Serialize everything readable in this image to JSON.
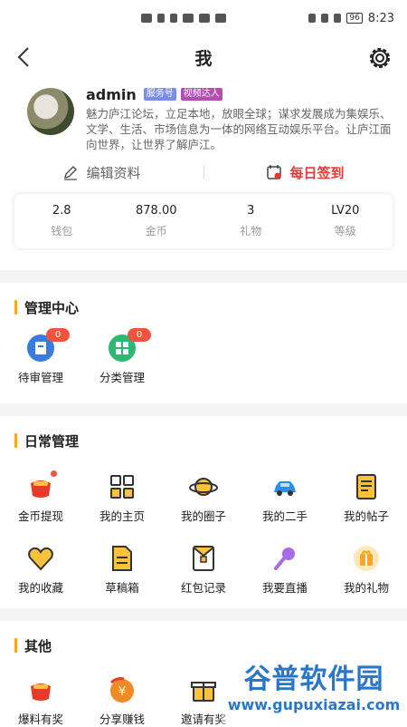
{
  "status_bar": {
    "time": "8:23",
    "battery": "96"
  },
  "nav": {
    "title": "我"
  },
  "profile": {
    "username": "admin",
    "tags": [
      "服务号",
      "视频达人"
    ],
    "description": "魅力庐江论坛，立足本地，放眼全球；谋求发展成为集娱乐、文学、生活、市场信息为一体的网络互动娱乐平台。让庐江面向世界，让世界了解庐江。"
  },
  "actions": {
    "edit_label": "编辑资料",
    "sign_label": "每日签到"
  },
  "stats": [
    {
      "value": "2.8",
      "label": "钱包"
    },
    {
      "value": "878.00",
      "label": "金币"
    },
    {
      "value": "3",
      "label": "礼物"
    },
    {
      "value": "LV20",
      "label": "等级"
    }
  ],
  "sections": {
    "manage": {
      "title": "管理中心",
      "items": [
        {
          "label": "待审管理",
          "badge": "0",
          "icon": "review-icon"
        },
        {
          "label": "分类管理",
          "badge": "0",
          "icon": "category-icon"
        }
      ]
    },
    "daily": {
      "title": "日常管理",
      "items": [
        {
          "label": "金币提现",
          "icon": "coin-withdraw-icon"
        },
        {
          "label": "我的主页",
          "icon": "grid-home-icon"
        },
        {
          "label": "我的圈子",
          "icon": "planet-icon"
        },
        {
          "label": "我的二手",
          "icon": "car-icon"
        },
        {
          "label": "我的帖子",
          "icon": "post-icon"
        },
        {
          "label": "我的收藏",
          "icon": "heart-icon"
        },
        {
          "label": "草稿箱",
          "icon": "draft-icon"
        },
        {
          "label": "红包记录",
          "icon": "red-envelope-icon"
        },
        {
          "label": "我要直播",
          "icon": "microphone-icon"
        },
        {
          "label": "我的礼物",
          "icon": "gift-icon"
        }
      ]
    },
    "other": {
      "title": "其他",
      "items": [
        {
          "label": "爆料有奖",
          "icon": "tip-reward-icon"
        },
        {
          "label": "分享赚钱",
          "icon": "share-earn-icon"
        },
        {
          "label": "邀请有奖",
          "icon": "invite-gift-icon"
        }
      ]
    }
  },
  "watermark": {
    "title": "谷普软件园",
    "url": "www.gupuxiazai.com"
  }
}
